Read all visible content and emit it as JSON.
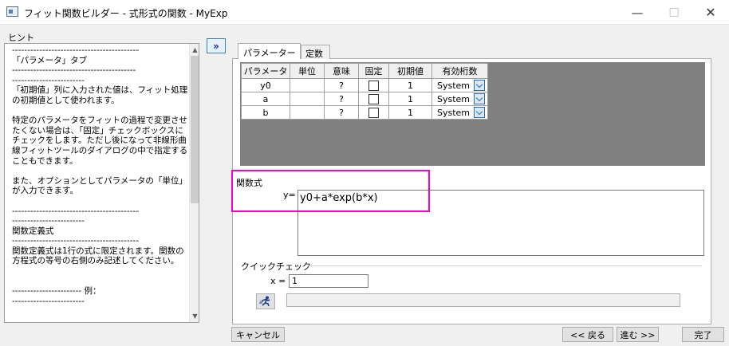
{
  "window": {
    "title": "フィット関数ビルダー - 式形式の関数 - MyExp",
    "minimize": "—",
    "maximize": "☐",
    "close": "✕"
  },
  "hint": {
    "label": "ヒント",
    "text": "------------------------------------------\n「パラメータ」タブ\n-----------------------------------------\n------------------------\n「初期値」列に入力された値は、フィット処理の初期値として使われます。\n\n特定のパラメータをフィットの過程で変更させたくない場合は、「固定」チェックボックスにチェックをします。ただし後になって非線形曲線フィットツールのダイアログの中で指定することもできます。\n\nまた、オプションとしてパラメータの「単位」が入力できます。\n\n------------------------------------------\n------------------------\n関数定義式\n------------------------------------------\n関数定義式は1行の式に限定されます。関数の方程式の等号の右側のみ記述してください。\n\n\n----------------------- 例：\n------------------------",
    "scroll_up": "▲",
    "scroll_down": "▼"
  },
  "expand_button": "»",
  "tabs": {
    "params": "パラメーター",
    "constants": "定数"
  },
  "param_table": {
    "headers": [
      "パラメータ",
      "単位",
      "意味",
      "固定",
      "初期値",
      "有効桁数"
    ],
    "rows": [
      {
        "name": "y0",
        "unit": "",
        "meaning": "?",
        "fixed": false,
        "initial": "1",
        "sig": "System"
      },
      {
        "name": "a",
        "unit": "",
        "meaning": "?",
        "fixed": false,
        "initial": "1",
        "sig": "System"
      },
      {
        "name": "b",
        "unit": "",
        "meaning": "?",
        "fixed": false,
        "initial": "1",
        "sig": "System"
      }
    ]
  },
  "function": {
    "label": "関数式",
    "y_label": "y=",
    "expression": "y0+a*exp(b*x)"
  },
  "quick_check": {
    "label": "クイックチェック",
    "x_label": "x =",
    "x_value": "1",
    "result": ""
  },
  "buttons": {
    "cancel": "キャンセル",
    "back": "<< 戻る",
    "next": "進む >>",
    "finish": "完了"
  },
  "colors": {
    "highlight": "#ff00cc",
    "grid_background": "#808080",
    "dropdown_accent": "#2a6bb4"
  }
}
